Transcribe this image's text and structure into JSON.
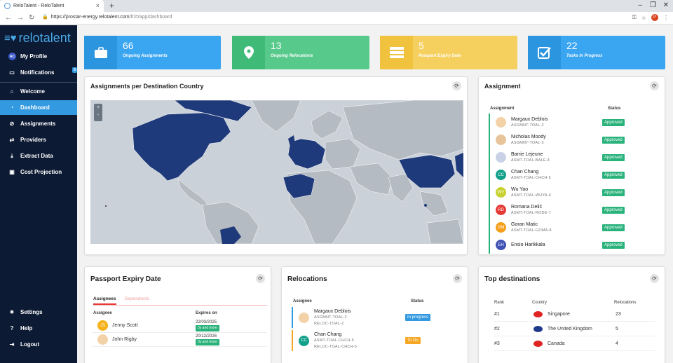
{
  "browser": {
    "tab_title": "ReloTalent - ReloTalent",
    "url_host": "https://prostar-energy.relotalent.com",
    "url_path": "/fr/#/app/dashboard",
    "profile_initial": "P"
  },
  "sidebar": {
    "logo": "relotalent",
    "profile": {
      "label": "My Profile",
      "initials": "AC"
    },
    "notifications": {
      "label": "Notifications",
      "badge": "5"
    },
    "items": [
      {
        "label": "Welcome",
        "icon": "home-icon"
      },
      {
        "label": "Dashboard",
        "icon": "dashboard-icon"
      },
      {
        "label": "Assignments",
        "icon": "compass-icon"
      },
      {
        "label": "Providers",
        "icon": "handshake-icon"
      },
      {
        "label": "Extract Data",
        "icon": "download-icon"
      },
      {
        "label": "Cost Projection",
        "icon": "money-icon"
      }
    ],
    "bottom": [
      {
        "label": "Settings",
        "icon": "gear-icon"
      },
      {
        "label": "Help",
        "icon": "question-icon"
      },
      {
        "label": "Logout",
        "icon": "logout-icon"
      }
    ]
  },
  "stats": [
    {
      "value": "66",
      "label": "Ongoing Assignments",
      "color": "#3aa5f0",
      "dark": "#2b95e0",
      "icon": "briefcase-icon"
    },
    {
      "value": "13",
      "label": "Ongoing Relocations",
      "color": "#57c98a",
      "dark": "#3fbb77",
      "icon": "location-pin-icon"
    },
    {
      "value": "5",
      "label": "Passport Expiry Date",
      "color": "#f5d05f",
      "dark": "#f0c23d",
      "icon": "passport-icon"
    },
    {
      "value": "22",
      "label": "Tasks In Progress",
      "color": "#3aa5f0",
      "dark": "#2b95e0",
      "icon": "checkbox-icon"
    }
  ],
  "map_card": {
    "title": "Assignments per Destination Country",
    "zoom_in": "+",
    "zoom_out": "-"
  },
  "assignment_card": {
    "title": "Assignment",
    "col_assignment": "Assignment",
    "col_status": "Status",
    "rows": [
      {
        "name": "Margaux Deblois",
        "code": "ASGMNT-TOAL-2",
        "status": "Approved",
        "initials": "",
        "avatar_color": "#f3d2a8"
      },
      {
        "name": "Nicholas Moody",
        "code": "ASGMNT-TOAL-3",
        "status": "Approved",
        "initials": "",
        "avatar_color": "#e8c49a"
      },
      {
        "name": "Barrie Lejeune",
        "code": "ASMT-TOAL-BALE-4",
        "status": "Approved",
        "initials": "",
        "avatar_color": "#c9d1e6"
      },
      {
        "name": "Chan Chang",
        "code": "ASMT-TOAL-CHCH-5",
        "status": "Approved",
        "initials": "CC",
        "avatar_color": "#11a08a"
      },
      {
        "name": "Wu Yao",
        "code": "ASMT-TOAL-WUYA-6",
        "status": "Approved",
        "initials": "WY",
        "avatar_color": "#c7d230"
      },
      {
        "name": "Romana Delić",
        "code": "ASMT-TOAL-RODE-7",
        "status": "Approved",
        "initials": "RD",
        "avatar_color": "#e53935"
      },
      {
        "name": "Goran Matic",
        "code": "ASMT-TOAL-GOMA-8",
        "status": "Approved",
        "initials": "GM",
        "avatar_color": "#f59f1b"
      },
      {
        "name": "Ensio Harikkala",
        "code": "",
        "status": "Approved",
        "initials": "EH",
        "avatar_color": "#3f51b5"
      }
    ]
  },
  "passport_card": {
    "title": "Passport Expiry Date",
    "tab_active": "Assignees",
    "tab_inactive": "Dependents",
    "col_assignee": "Assignee",
    "col_expires": "Expires on",
    "rows": [
      {
        "name": "Jenny Scott",
        "initials": "JS",
        "avatar_color": "#f5b21b",
        "date": "22/03/2025",
        "badge": "3y and more"
      },
      {
        "name": "John Rigby",
        "initials": "",
        "avatar_color": "#f3d2a8",
        "date": "20/12/2026",
        "badge": "3y and more"
      }
    ]
  },
  "relocations_card": {
    "title": "Relocations",
    "col_assignee": "Assignee",
    "col_status": "Status",
    "rows": [
      {
        "name": "Margaux Deblois",
        "code1": "ASGMNT-TOAL-2",
        "code2": "RELOC-TOAL-2",
        "status": "In progress",
        "status_color": "#3399e0",
        "initials": "",
        "avatar_color": "#f3d2a8",
        "bar": "#3399e0"
      },
      {
        "name": "Chan Chang",
        "code1": "ASMT-TOAL-CHCH-5",
        "code2": "RELOC-TOAL-CHCH-5",
        "status": "To Do",
        "status_color": "#f5a623",
        "initials": "CC",
        "avatar_color": "#11a08a",
        "bar": "#f5a623"
      }
    ]
  },
  "destinations_card": {
    "title": "Top destinations",
    "col_rank": "Rank",
    "col_country": "Country",
    "col_relocations": "Relocations",
    "rows": [
      {
        "rank": "#1",
        "country": "Singapore",
        "count": "23",
        "flag": "#e02424"
      },
      {
        "rank": "#2",
        "country": "The United Kingdom",
        "count": "5",
        "flag": "#1f3a8a"
      },
      {
        "rank": "#3",
        "country": "Canada",
        "count": "4",
        "flag": "#e02424"
      }
    ]
  }
}
